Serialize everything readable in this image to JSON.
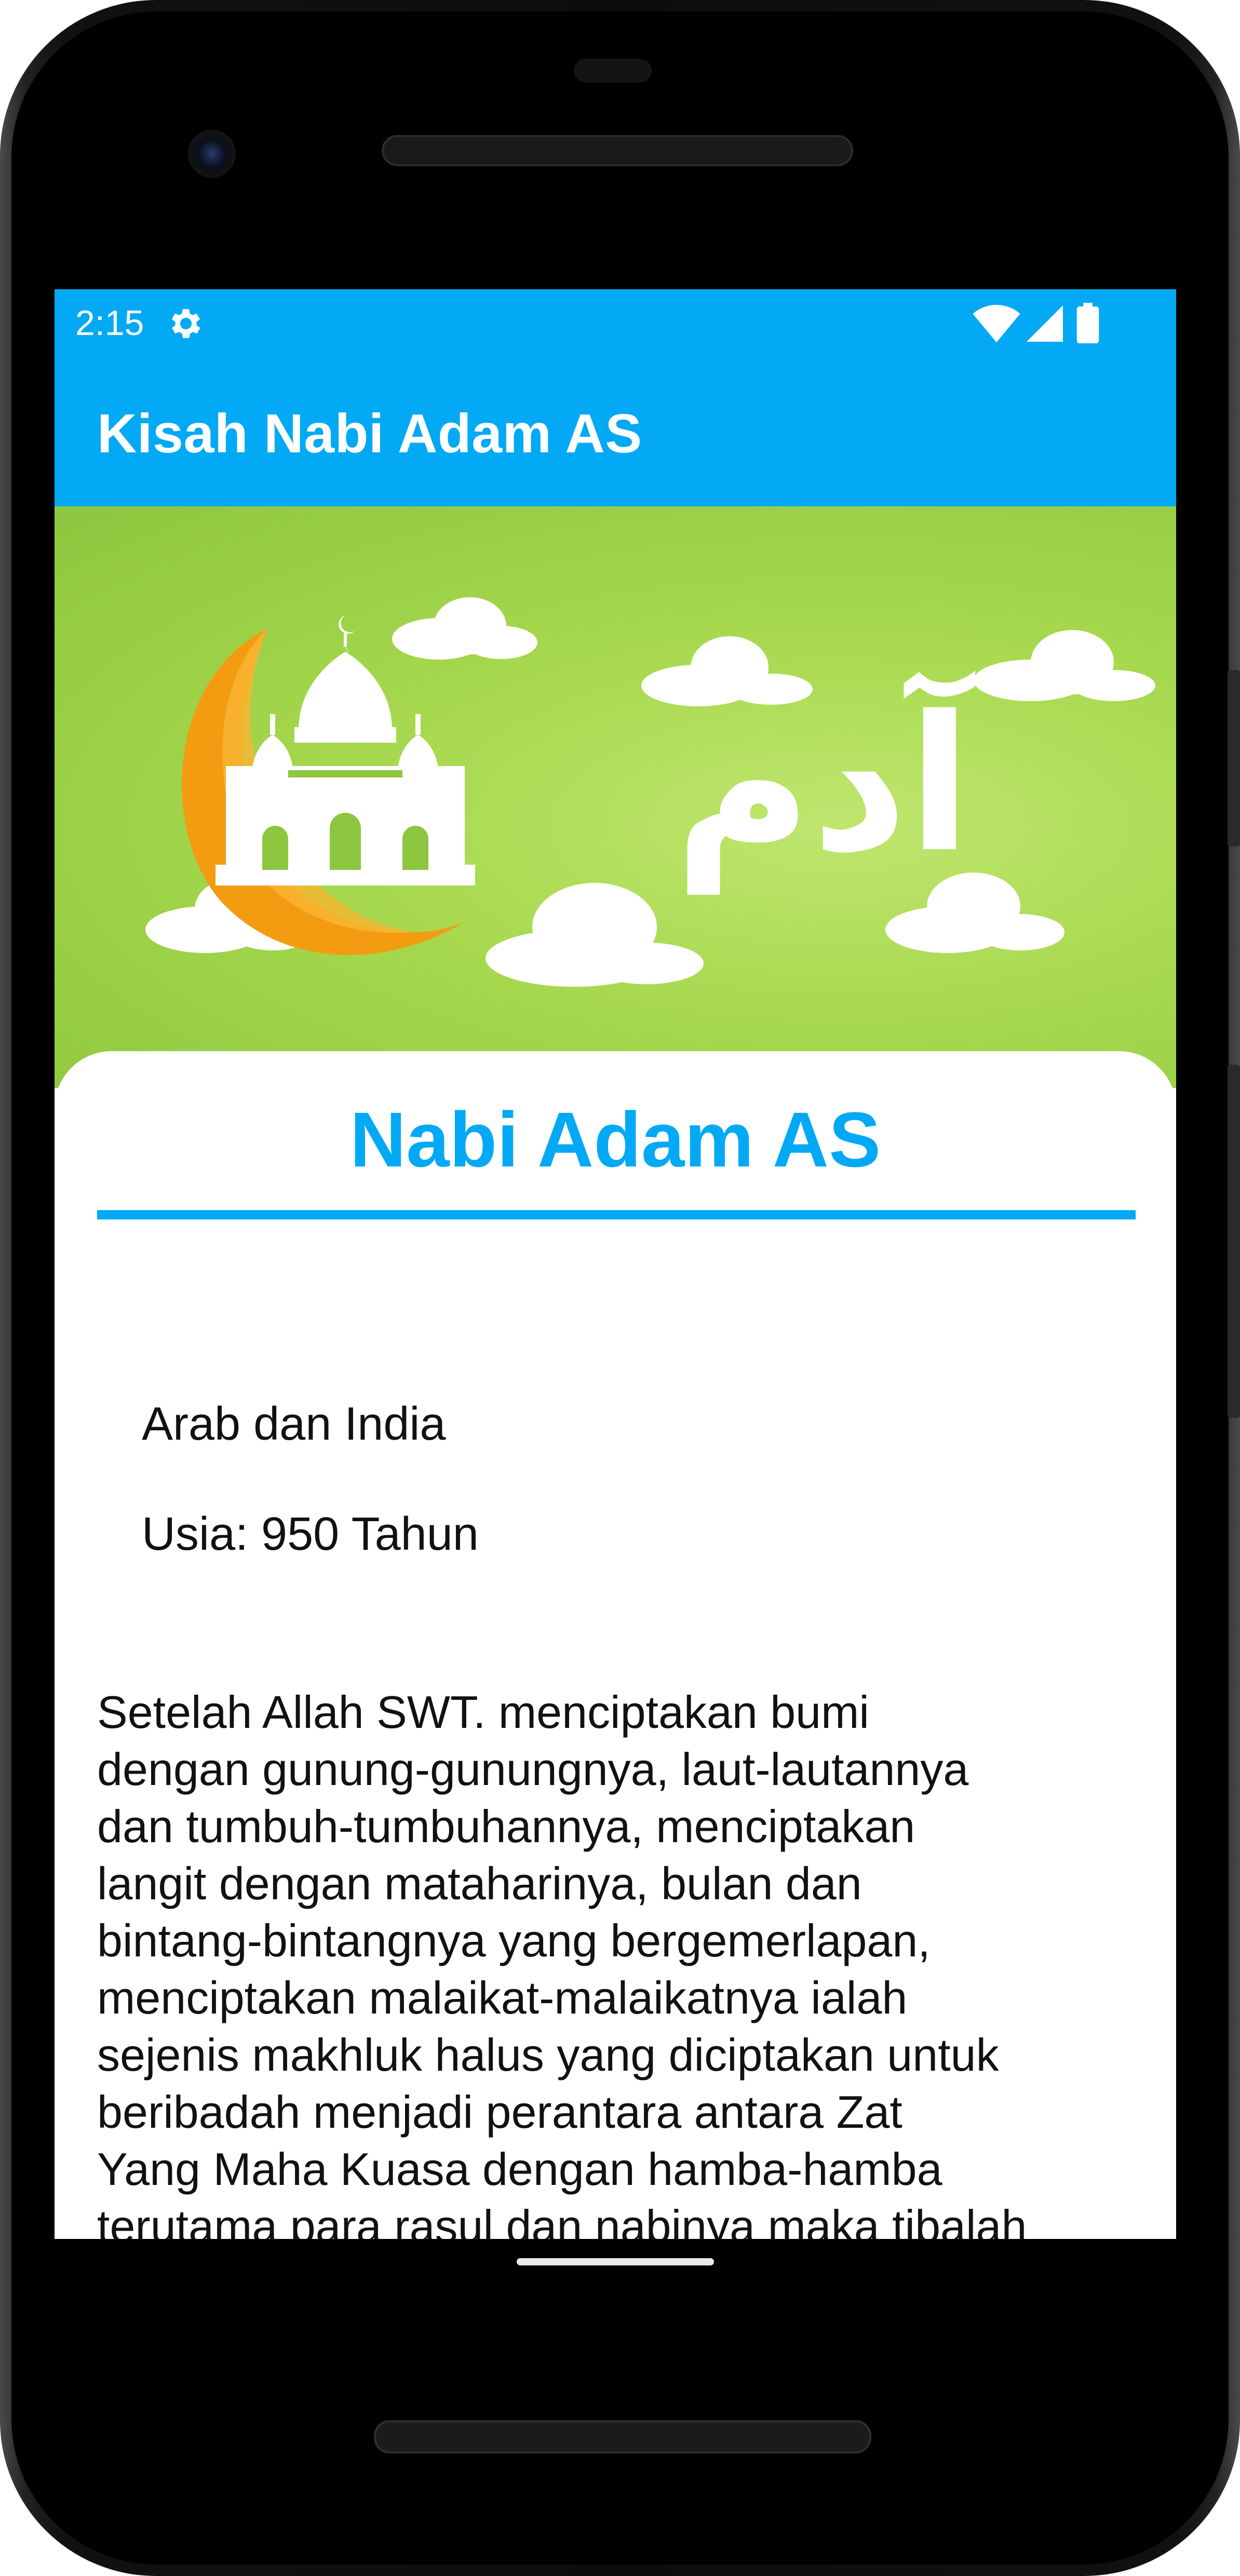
{
  "status_bar": {
    "time": "2:15",
    "icons": [
      "gear-icon",
      "wifi-icon",
      "signal-icon",
      "battery-icon"
    ]
  },
  "app_bar": {
    "title": "Kisah Nabi Adam AS"
  },
  "banner": {
    "arabic_text": "آدم",
    "icons": [
      "crescent-moon-icon",
      "mosque-icon",
      "cloud-icon"
    ]
  },
  "card": {
    "title": "Nabi Adam AS",
    "origin": "Arab dan India",
    "age": "Usia: 950 Tahun",
    "story_lines": [
      "Setelah Allah SWT. menciptakan bumi",
      "dengan gunung-gunungnya, laut-lautannya",
      "dan tumbuh-tumbuhannya, menciptakan",
      "langit dengan mataharinya, bulan dan",
      "bintang-bintangnya yang bergemerlapan,",
      "menciptakan malaikat-malaikatnya ialah",
      "sejenis makhluk halus yang diciptakan untuk",
      "beribadah menjadi perantara antara Zat",
      "Yang Maha Kuasa dengan hamba-hamba",
      "terutama para rasul dan nabinya maka tibalah"
    ]
  },
  "colors": {
    "primary": "#03a9f4",
    "banner_green": "#9bcf45",
    "crescent_orange": "#f39c12"
  }
}
